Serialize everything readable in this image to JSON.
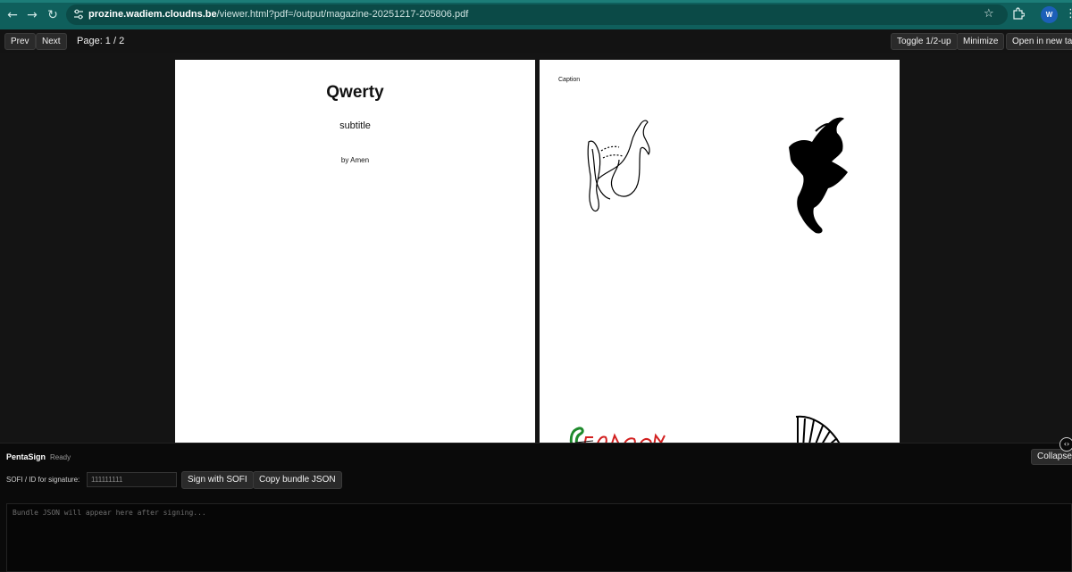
{
  "browser": {
    "url_host": "prozine.wadiem.cloudns.be",
    "url_path": "/viewer.html?pdf=/output/magazine-20251217-205806.pdf",
    "profile_initial": "W"
  },
  "toolbar": {
    "prev_label": "Prev",
    "next_label": "Next",
    "page_indicator": "Page: 1 / 2",
    "toggle_label": "Toggle 1/2-up",
    "minimize_label": "Minimize",
    "open_new_tab_label": "Open in new tab"
  },
  "pages": {
    "page1": {
      "title": "Qwerty",
      "subtitle": "subtitle",
      "byline": "by Amen"
    },
    "page2": {
      "caption": "Caption"
    }
  },
  "panel": {
    "title": "PentaSign",
    "status": "Ready",
    "collapse_label": "Collapse",
    "sofi_label": "SOFI / ID for signature:",
    "sofi_value": "111111111",
    "sign_label": "Sign with SOFI",
    "copy_label": "Copy bundle JSON",
    "bundle_placeholder": "Bundle JSON will appear here after signing..."
  },
  "icons": {
    "back": "arrow-left-icon",
    "forward": "arrow-right-icon",
    "reload": "reload-icon",
    "site_info": "site-info-icon",
    "bookmark": "star-icon",
    "extensions": "puzzle-icon",
    "menu": "kebab-menu-icon",
    "panel_toggle": "code-toggle-icon"
  },
  "colors": {
    "chrome": "#0f5f5c",
    "background": "#131313",
    "profile": "#1c5fb8"
  }
}
